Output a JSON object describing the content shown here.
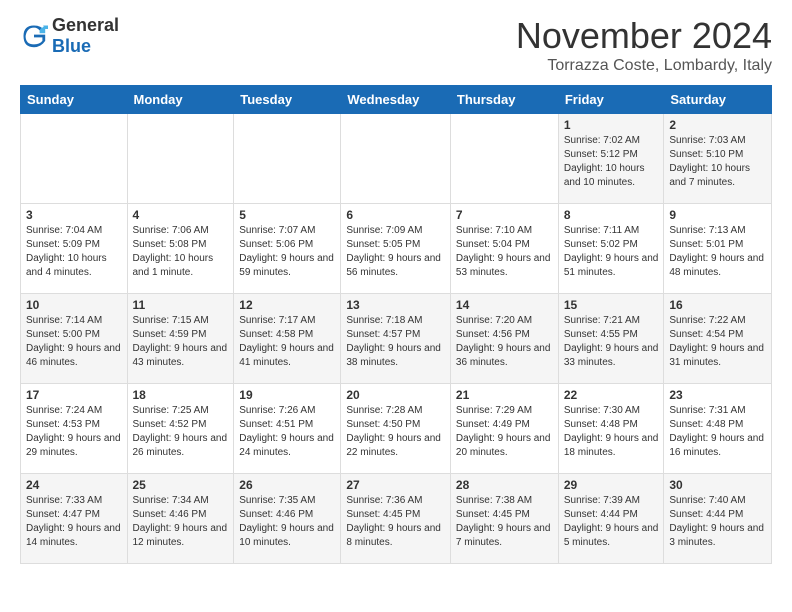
{
  "header": {
    "logo_general": "General",
    "logo_blue": "Blue",
    "month_title": "November 2024",
    "location": "Torrazza Coste, Lombardy, Italy"
  },
  "calendar": {
    "days_of_week": [
      "Sunday",
      "Monday",
      "Tuesday",
      "Wednesday",
      "Thursday",
      "Friday",
      "Saturday"
    ],
    "weeks": [
      [
        {
          "day": "",
          "info": ""
        },
        {
          "day": "",
          "info": ""
        },
        {
          "day": "",
          "info": ""
        },
        {
          "day": "",
          "info": ""
        },
        {
          "day": "",
          "info": ""
        },
        {
          "day": "1",
          "info": "Sunrise: 7:02 AM\nSunset: 5:12 PM\nDaylight: 10 hours and 10 minutes."
        },
        {
          "day": "2",
          "info": "Sunrise: 7:03 AM\nSunset: 5:10 PM\nDaylight: 10 hours and 7 minutes."
        }
      ],
      [
        {
          "day": "3",
          "info": "Sunrise: 7:04 AM\nSunset: 5:09 PM\nDaylight: 10 hours and 4 minutes."
        },
        {
          "day": "4",
          "info": "Sunrise: 7:06 AM\nSunset: 5:08 PM\nDaylight: 10 hours and 1 minute."
        },
        {
          "day": "5",
          "info": "Sunrise: 7:07 AM\nSunset: 5:06 PM\nDaylight: 9 hours and 59 minutes."
        },
        {
          "day": "6",
          "info": "Sunrise: 7:09 AM\nSunset: 5:05 PM\nDaylight: 9 hours and 56 minutes."
        },
        {
          "day": "7",
          "info": "Sunrise: 7:10 AM\nSunset: 5:04 PM\nDaylight: 9 hours and 53 minutes."
        },
        {
          "day": "8",
          "info": "Sunrise: 7:11 AM\nSunset: 5:02 PM\nDaylight: 9 hours and 51 minutes."
        },
        {
          "day": "9",
          "info": "Sunrise: 7:13 AM\nSunset: 5:01 PM\nDaylight: 9 hours and 48 minutes."
        }
      ],
      [
        {
          "day": "10",
          "info": "Sunrise: 7:14 AM\nSunset: 5:00 PM\nDaylight: 9 hours and 46 minutes."
        },
        {
          "day": "11",
          "info": "Sunrise: 7:15 AM\nSunset: 4:59 PM\nDaylight: 9 hours and 43 minutes."
        },
        {
          "day": "12",
          "info": "Sunrise: 7:17 AM\nSunset: 4:58 PM\nDaylight: 9 hours and 41 minutes."
        },
        {
          "day": "13",
          "info": "Sunrise: 7:18 AM\nSunset: 4:57 PM\nDaylight: 9 hours and 38 minutes."
        },
        {
          "day": "14",
          "info": "Sunrise: 7:20 AM\nSunset: 4:56 PM\nDaylight: 9 hours and 36 minutes."
        },
        {
          "day": "15",
          "info": "Sunrise: 7:21 AM\nSunset: 4:55 PM\nDaylight: 9 hours and 33 minutes."
        },
        {
          "day": "16",
          "info": "Sunrise: 7:22 AM\nSunset: 4:54 PM\nDaylight: 9 hours and 31 minutes."
        }
      ],
      [
        {
          "day": "17",
          "info": "Sunrise: 7:24 AM\nSunset: 4:53 PM\nDaylight: 9 hours and 29 minutes."
        },
        {
          "day": "18",
          "info": "Sunrise: 7:25 AM\nSunset: 4:52 PM\nDaylight: 9 hours and 26 minutes."
        },
        {
          "day": "19",
          "info": "Sunrise: 7:26 AM\nSunset: 4:51 PM\nDaylight: 9 hours and 24 minutes."
        },
        {
          "day": "20",
          "info": "Sunrise: 7:28 AM\nSunset: 4:50 PM\nDaylight: 9 hours and 22 minutes."
        },
        {
          "day": "21",
          "info": "Sunrise: 7:29 AM\nSunset: 4:49 PM\nDaylight: 9 hours and 20 minutes."
        },
        {
          "day": "22",
          "info": "Sunrise: 7:30 AM\nSunset: 4:48 PM\nDaylight: 9 hours and 18 minutes."
        },
        {
          "day": "23",
          "info": "Sunrise: 7:31 AM\nSunset: 4:48 PM\nDaylight: 9 hours and 16 minutes."
        }
      ],
      [
        {
          "day": "24",
          "info": "Sunrise: 7:33 AM\nSunset: 4:47 PM\nDaylight: 9 hours and 14 minutes."
        },
        {
          "day": "25",
          "info": "Sunrise: 7:34 AM\nSunset: 4:46 PM\nDaylight: 9 hours and 12 minutes."
        },
        {
          "day": "26",
          "info": "Sunrise: 7:35 AM\nSunset: 4:46 PM\nDaylight: 9 hours and 10 minutes."
        },
        {
          "day": "27",
          "info": "Sunrise: 7:36 AM\nSunset: 4:45 PM\nDaylight: 9 hours and 8 minutes."
        },
        {
          "day": "28",
          "info": "Sunrise: 7:38 AM\nSunset: 4:45 PM\nDaylight: 9 hours and 7 minutes."
        },
        {
          "day": "29",
          "info": "Sunrise: 7:39 AM\nSunset: 4:44 PM\nDaylight: 9 hours and 5 minutes."
        },
        {
          "day": "30",
          "info": "Sunrise: 7:40 AM\nSunset: 4:44 PM\nDaylight: 9 hours and 3 minutes."
        }
      ]
    ]
  }
}
